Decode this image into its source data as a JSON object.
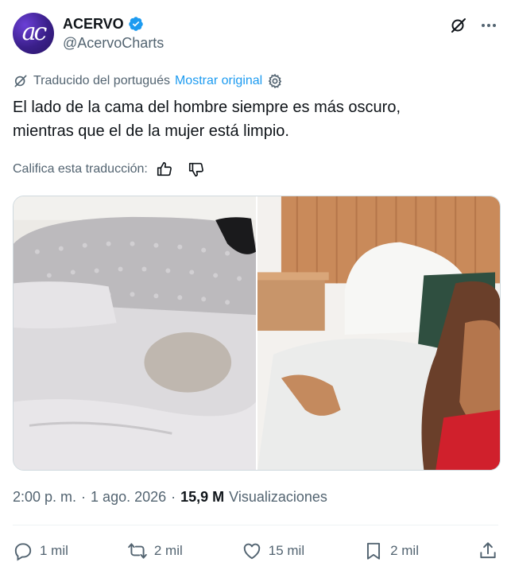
{
  "author": {
    "display_name": "ACERVO",
    "handle": "@AcervoCharts",
    "avatar_text": "ac"
  },
  "translation": {
    "label": "Traducido del portugués",
    "show_original": "Mostrar original"
  },
  "tweet": {
    "line1": "El lado de la cama del hombre siempre es más oscuro,",
    "line2": "mientras que el de la mujer está limpio."
  },
  "rate": {
    "label": "Califica esta traducción:"
  },
  "meta": {
    "time": "2:00 p. m.",
    "date": "1 ago. 2026",
    "views_count": "15,9 M",
    "views_label": "Visualizaciones"
  },
  "actions": {
    "reply_count": "1 mil",
    "retweet_count": "2 mil",
    "like_count": "15 mil",
    "bookmark_count": "2 mil"
  },
  "colors": {
    "accent": "#1d9bf0",
    "text_secondary": "#536471"
  }
}
